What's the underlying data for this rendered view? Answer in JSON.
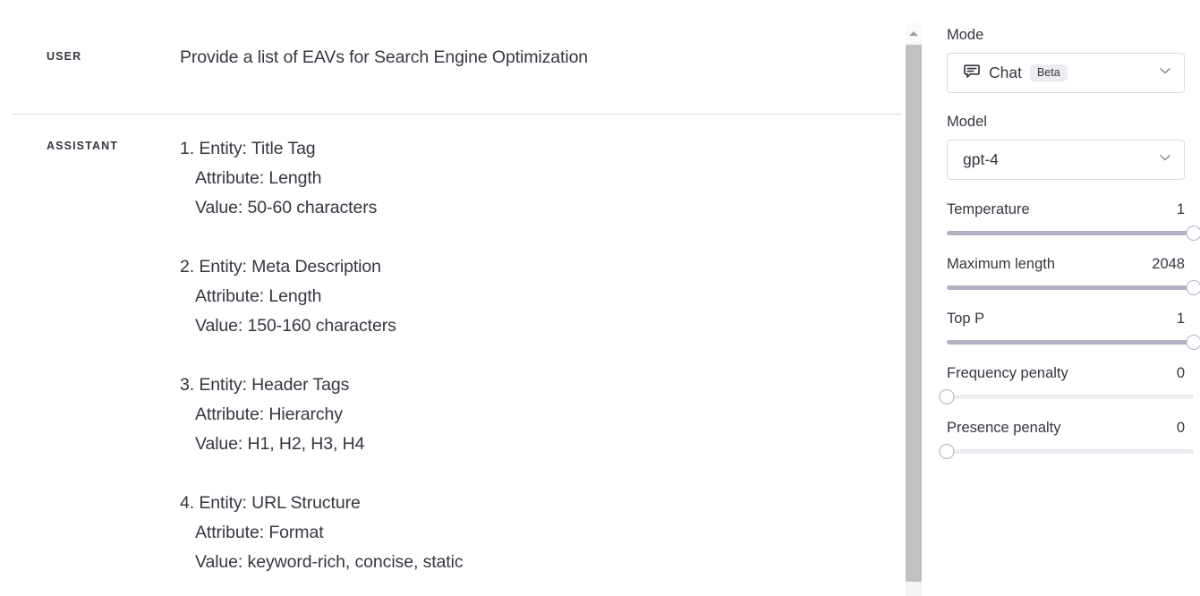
{
  "chat": {
    "messages": [
      {
        "role": "USER",
        "text": "Provide a list of EAVs for Search Engine Optimization"
      },
      {
        "role": "ASSISTANT",
        "items": [
          {
            "entity": "1. Entity: Title Tag",
            "attribute": "Attribute: Length",
            "value": "Value: 50-60 characters"
          },
          {
            "entity": "2. Entity: Meta Description",
            "attribute": "Attribute: Length",
            "value": "Value: 150-160 characters"
          },
          {
            "entity": "3. Entity: Header Tags",
            "attribute": "Attribute: Hierarchy",
            "value": "Value: H1, H2, H3, H4"
          },
          {
            "entity": "4. Entity: URL Structure",
            "attribute": "Attribute: Format",
            "value": "Value: keyword-rich, concise, static"
          }
        ]
      }
    ]
  },
  "settings": {
    "mode": {
      "label": "Mode",
      "value": "Chat",
      "badge": "Beta",
      "icon": "chat-bubble-icon",
      "chevron": "chevron-down-icon"
    },
    "model": {
      "label": "Model",
      "value": "gpt-4",
      "chevron": "chevron-down-icon"
    },
    "sliders": [
      {
        "name": "Temperature",
        "value": "1",
        "fill_percent": 100
      },
      {
        "name": "Maximum length",
        "value": "2048",
        "fill_percent": 100
      },
      {
        "name": "Top P",
        "value": "1",
        "fill_percent": 100
      },
      {
        "name": "Frequency penalty",
        "value": "0",
        "fill_percent": 0
      },
      {
        "name": "Presence penalty",
        "value": "0",
        "fill_percent": 0
      }
    ]
  },
  "scrollbar": {
    "up_arrow": "scroll-up-arrow-icon"
  },
  "colors": {
    "text": "#353740",
    "border": "#d9d9e3",
    "slider_fill": "#b1b1c4",
    "slider_rail": "#ececf1",
    "badge_bg": "#ececf1",
    "scroll_thumb": "#c1c1c1"
  }
}
